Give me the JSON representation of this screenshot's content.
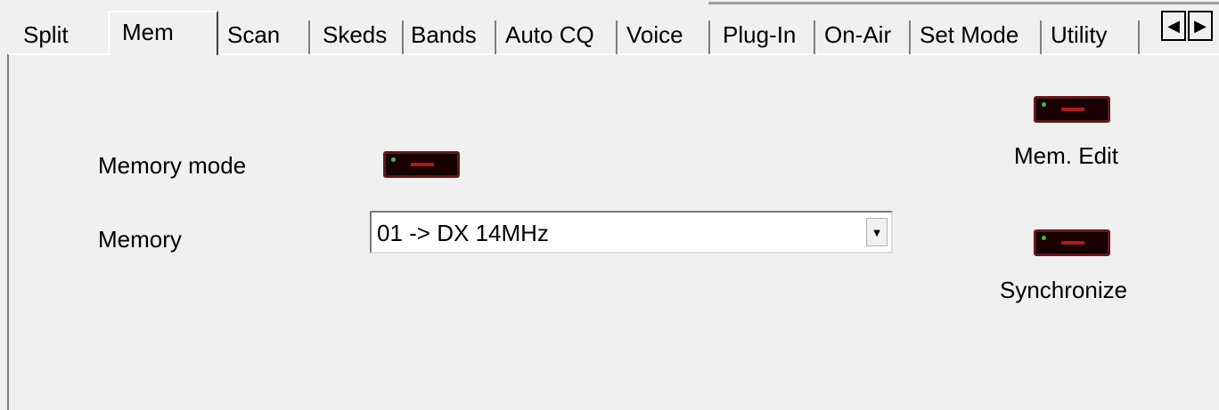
{
  "tabs": [
    {
      "label": "Split"
    },
    {
      "label": "Mem"
    },
    {
      "label": "Scan"
    },
    {
      "label": "Skeds"
    },
    {
      "label": "Bands"
    },
    {
      "label": "Auto CQ"
    },
    {
      "label": "Voice"
    },
    {
      "label": "Plug-In"
    },
    {
      "label": "On-Air"
    },
    {
      "label": "Set Mode"
    },
    {
      "label": "Utility"
    }
  ],
  "active_tab": "Mem",
  "scroll": {
    "left_icon": "triangle-left-icon",
    "right_icon": "triangle-right-icon",
    "left_glyph": "◀",
    "right_glyph": "▶"
  },
  "memory_mode": {
    "label": "Memory mode",
    "led_state": "off"
  },
  "memory": {
    "label": "Memory",
    "selected": "01 -> DX 14MHz",
    "arrow_glyph": "▼"
  },
  "mem_edit": {
    "label": "Mem. Edit",
    "led_state": "off"
  },
  "synchronize": {
    "label": "Synchronize",
    "led_state": "off"
  },
  "colors": {
    "background": "#f0f0f0",
    "led_frame": "#6b1414",
    "led_bar": "#b01818",
    "led_dot": "#3fbf3f"
  }
}
